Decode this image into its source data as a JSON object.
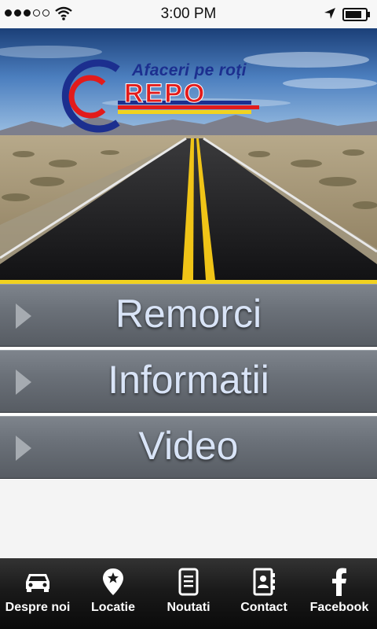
{
  "status_bar": {
    "time": "3:00 PM",
    "signal_dots": [
      true,
      true,
      true,
      false,
      false
    ],
    "icons": [
      "wifi-icon",
      "location-arrow-icon",
      "battery-icon"
    ]
  },
  "hero": {
    "logo_tagline": "Afaceri pe roți",
    "logo_brand": "REPO",
    "brand_colors": {
      "blue": "#1c2f8f",
      "red": "#e21b1b",
      "yellow": "#f2d21f"
    }
  },
  "menu": {
    "items": [
      {
        "label": "Remorci",
        "icon": "chevron-right-icon"
      },
      {
        "label": "Informatii",
        "icon": "chevron-right-icon"
      },
      {
        "label": "Video",
        "icon": "chevron-right-icon"
      }
    ]
  },
  "tab_bar": {
    "tabs": [
      {
        "label": "Despre noi",
        "icon": "car-icon"
      },
      {
        "label": "Locatie",
        "icon": "map-pin-star-icon"
      },
      {
        "label": "Noutati",
        "icon": "document-icon"
      },
      {
        "label": "Contact",
        "icon": "address-book-icon"
      },
      {
        "label": "Facebook",
        "icon": "facebook-icon"
      }
    ]
  }
}
